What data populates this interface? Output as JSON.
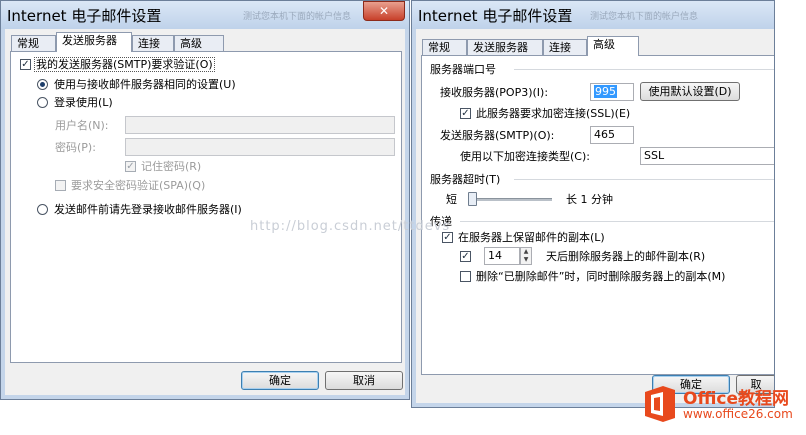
{
  "watermark": "http://blog.csdn.net/ttdevs",
  "logo": {
    "name": "Office教程网",
    "url": "www.office26.com"
  },
  "left": {
    "title": "Internet 电子邮件设置",
    "ghost_title": "测试您本机下面的帐户信息",
    "close": "✕",
    "tabs": [
      "常规",
      "发送服务器",
      "连接",
      "高级"
    ],
    "auth_checkbox": "我的发送服务器(SMTP)要求验证(O)",
    "same_settings": "使用与接收邮件服务器相同的设置(U)",
    "login_using": "登录使用(L)",
    "username_label": "用户名(N):",
    "password_label": "密码(P):",
    "remember_password": "记住密码(R)",
    "spa": "要求安全密码验证(SPA)(Q)",
    "login_before": "发送邮件前请先登录接收邮件服务器(I)",
    "ok": "确定",
    "cancel": "取消"
  },
  "right": {
    "title": "Internet 电子邮件设置",
    "ghost_title": "测试您本机下面的帐户信息",
    "tabs": [
      "常规",
      "发送服务器",
      "连接",
      "高级"
    ],
    "ports_group": "服务器端口号",
    "incoming_label": "接收服务器(POP3)(I):",
    "incoming_value": "995",
    "use_defaults": "使用默认设置(D)",
    "ssl_required": "此服务器要求加密连接(SSL)(E)",
    "outgoing_label": "发送服务器(SMTP)(O):",
    "outgoing_value": "465",
    "encryption_label": "使用以下加密连接类型(C):",
    "encryption_value": "SSL",
    "timeout_group": "服务器超时(T)",
    "timeout_short": "短",
    "timeout_long": "长 1 分钟",
    "timeout_level": 0.0,
    "delivery_group": "传递",
    "leave_copy": "在服务器上保留邮件的副本(L)",
    "days_value": "14",
    "days_label": "天后删除服务器上的邮件副本(R)",
    "delete_when_deleted": "删除“已删除邮件”时，同时删除服务器上的副本(M)",
    "ok": "确定",
    "cancel": "取"
  }
}
